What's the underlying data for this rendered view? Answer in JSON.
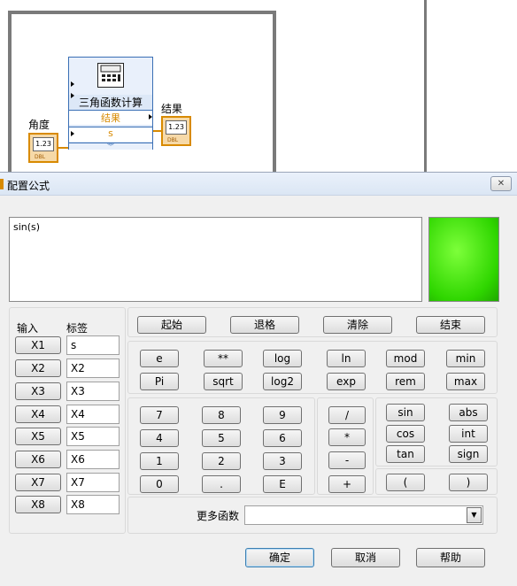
{
  "diagram": {
    "formula_node": {
      "title": "三角函数计算",
      "output_row": "结果",
      "input_row": "s"
    },
    "input_label": "角度",
    "output_label": "结果",
    "terminal_value": "1.23",
    "terminal_type": "DBL"
  },
  "dialog": {
    "title": "配置公式",
    "close_label": "✕",
    "formula_text": "sin(s)",
    "input_header": "输入",
    "label_header": "标签",
    "inputs": [
      {
        "button": "X1",
        "label": "s"
      },
      {
        "button": "X2",
        "label": "X2"
      },
      {
        "button": "X3",
        "label": "X3"
      },
      {
        "button": "X4",
        "label": "X4"
      },
      {
        "button": "X5",
        "label": "X5"
      },
      {
        "button": "X6",
        "label": "X6"
      },
      {
        "button": "X7",
        "label": "X7"
      },
      {
        "button": "X8",
        "label": "X8"
      }
    ],
    "edit_buttons": {
      "home": "起始",
      "backspace": "退格",
      "clear": "清除",
      "end": "结束"
    },
    "func_row1": [
      "e",
      "**",
      "log",
      "ln",
      "mod",
      "min"
    ],
    "func_row2": [
      "Pi",
      "sqrt",
      "log2",
      "exp",
      "rem",
      "max"
    ],
    "digits": [
      "7",
      "8",
      "9",
      "4",
      "5",
      "6",
      "1",
      "2",
      "3",
      "0",
      ".",
      "E"
    ],
    "operators": [
      "/",
      "*",
      "-",
      "+"
    ],
    "trig": [
      "sin",
      "cos",
      "tan"
    ],
    "misc": [
      "abs",
      "int",
      "sign"
    ],
    "parens": [
      "(",
      ")"
    ],
    "more_functions_label": "更多函数",
    "more_functions_value": "",
    "ok_label": "确定",
    "cancel_label": "取消",
    "help_label": "帮助"
  },
  "colors": {
    "accent_orange": "#d88a00",
    "led_green": "#2fd600",
    "node_border": "#3a6fb5"
  }
}
